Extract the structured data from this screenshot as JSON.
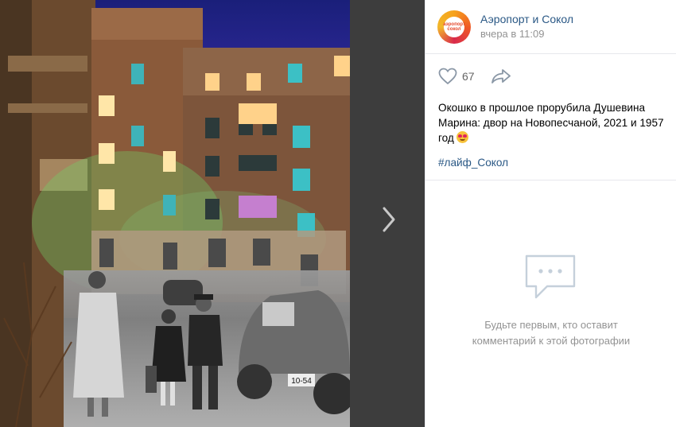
{
  "post": {
    "group_name": "Аэропорт и Сокол",
    "avatar_text": "аэропорт сокол",
    "time": "вчера в 11:09",
    "likes": "67",
    "caption": "Окошко в прошлое прорубила Душевина Марина: двор на Новопесчаной, 2021 и 1957 год",
    "hashtag": "#лайф_Сокол"
  },
  "photo": {
    "car_plate": "10-54"
  },
  "comments": {
    "empty_line1": "Будьте первым, кто оставит",
    "empty_line2": "комментарий к этой фотографии"
  },
  "icons": {
    "like": "heart-icon",
    "share": "share-arrow-icon",
    "next": "chevron-right-icon",
    "empty": "comments-icon"
  },
  "colors": {
    "link": "#2a5885",
    "muted": "#939393",
    "divider": "#e7e8ec"
  }
}
